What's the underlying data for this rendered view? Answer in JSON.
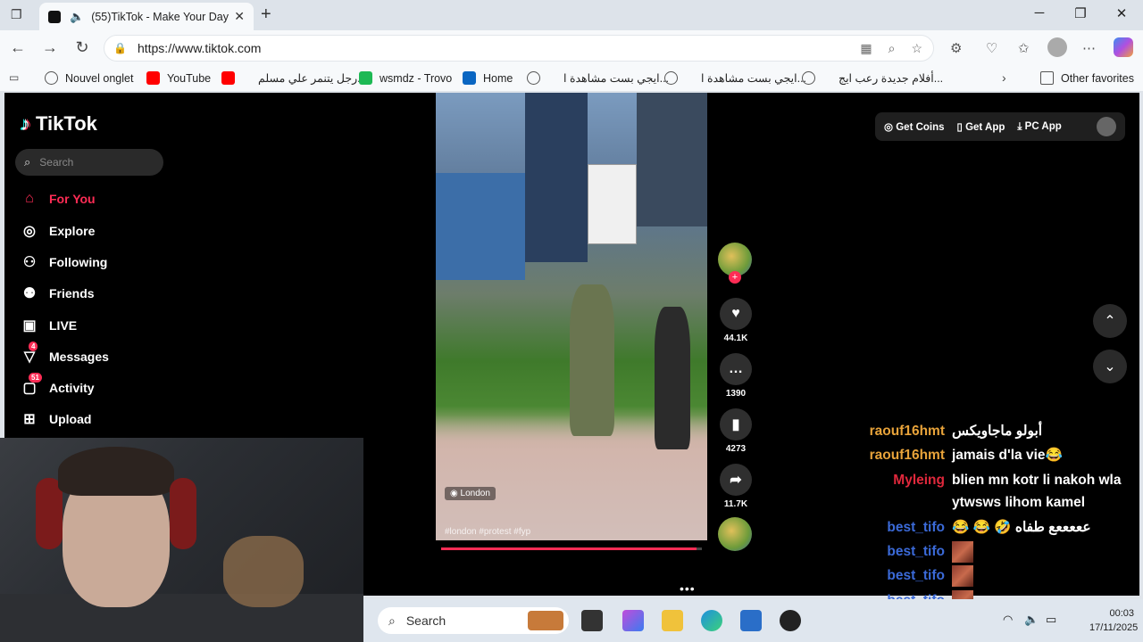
{
  "browser": {
    "tab_title": "(55)TikTok - Make Your Day",
    "url": "https://www.tiktok.com",
    "favorites": [
      "Nouvel onglet",
      "YouTube",
      "رجل يتنمر علي مسلم...",
      "wsmdz - Trovo",
      "Home",
      "ايجي بست مشاهدة ا...",
      "ايجي بست مشاهدة ا...",
      "أفلام جديدة رعب ايج..."
    ],
    "other_favorites": "Other favorites"
  },
  "tiktok": {
    "logo": "TikTok",
    "search_placeholder": "Search",
    "nav": [
      {
        "label": "For You",
        "icon": "home-icon",
        "active": true
      },
      {
        "label": "Explore",
        "icon": "compass-icon"
      },
      {
        "label": "Following",
        "icon": "following-icon"
      },
      {
        "label": "Friends",
        "icon": "friends-icon"
      },
      {
        "label": "LIVE",
        "icon": "live-icon"
      },
      {
        "label": "Messages",
        "icon": "messages-icon",
        "badge": "4"
      },
      {
        "label": "Activity",
        "icon": "activity-icon",
        "badge": "51"
      },
      {
        "label": "Upload",
        "icon": "upload-icon"
      }
    ],
    "top_buttons": {
      "get_coins": "Get Coins",
      "get_app": "Get App",
      "pc_app": "PC App"
    },
    "video": {
      "location": "London",
      "caption": "#london #protest #fyp",
      "progress": 0.98
    },
    "actions": {
      "likes": "44.1K",
      "comments": "1390",
      "saves": "4273",
      "shares": "11.7K"
    }
  },
  "chat": [
    {
      "user": "raouf16hmt",
      "msg": "أبولو ماجاويكس",
      "color": "#e8a33a"
    },
    {
      "user": "raouf16hmt",
      "msg": "jamais d'la vie😂",
      "color": "#e8a33a"
    },
    {
      "user": "Myleing",
      "msg": "blien mn kotr li nakoh wla",
      "msg2": "ytwsws lihom kamel",
      "color": "#e0283c"
    },
    {
      "user": "best_tifo",
      "msg": "😂 😂 🤣 عععععع طفاه",
      "color": "#3b6ad8"
    },
    {
      "user": "best_tifo",
      "msg": "",
      "emote": true,
      "color": "#3b6ad8"
    },
    {
      "user": "best_tifo",
      "msg": "",
      "emote": true,
      "color": "#3b6ad8"
    },
    {
      "user": "best_tifo",
      "msg": "",
      "emote": true,
      "color": "#3b6ad8"
    },
    {
      "user": "best_tifo",
      "msg": "",
      "emote": true,
      "color": "#3b6ad8"
    }
  ],
  "taskbar": {
    "search": "Search",
    "time": "00:03",
    "date": "17/11/2025"
  }
}
